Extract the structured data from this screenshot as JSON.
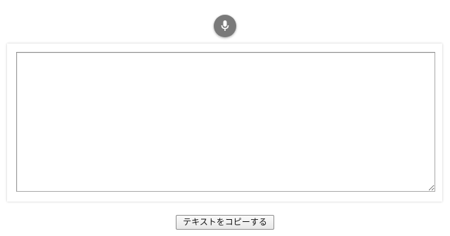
{
  "mic": {
    "icon": "microphone-icon",
    "background_color": "#7a7a7a"
  },
  "transcript": {
    "value": "",
    "placeholder": ""
  },
  "copy_button": {
    "label": "テキストをコピーする"
  }
}
